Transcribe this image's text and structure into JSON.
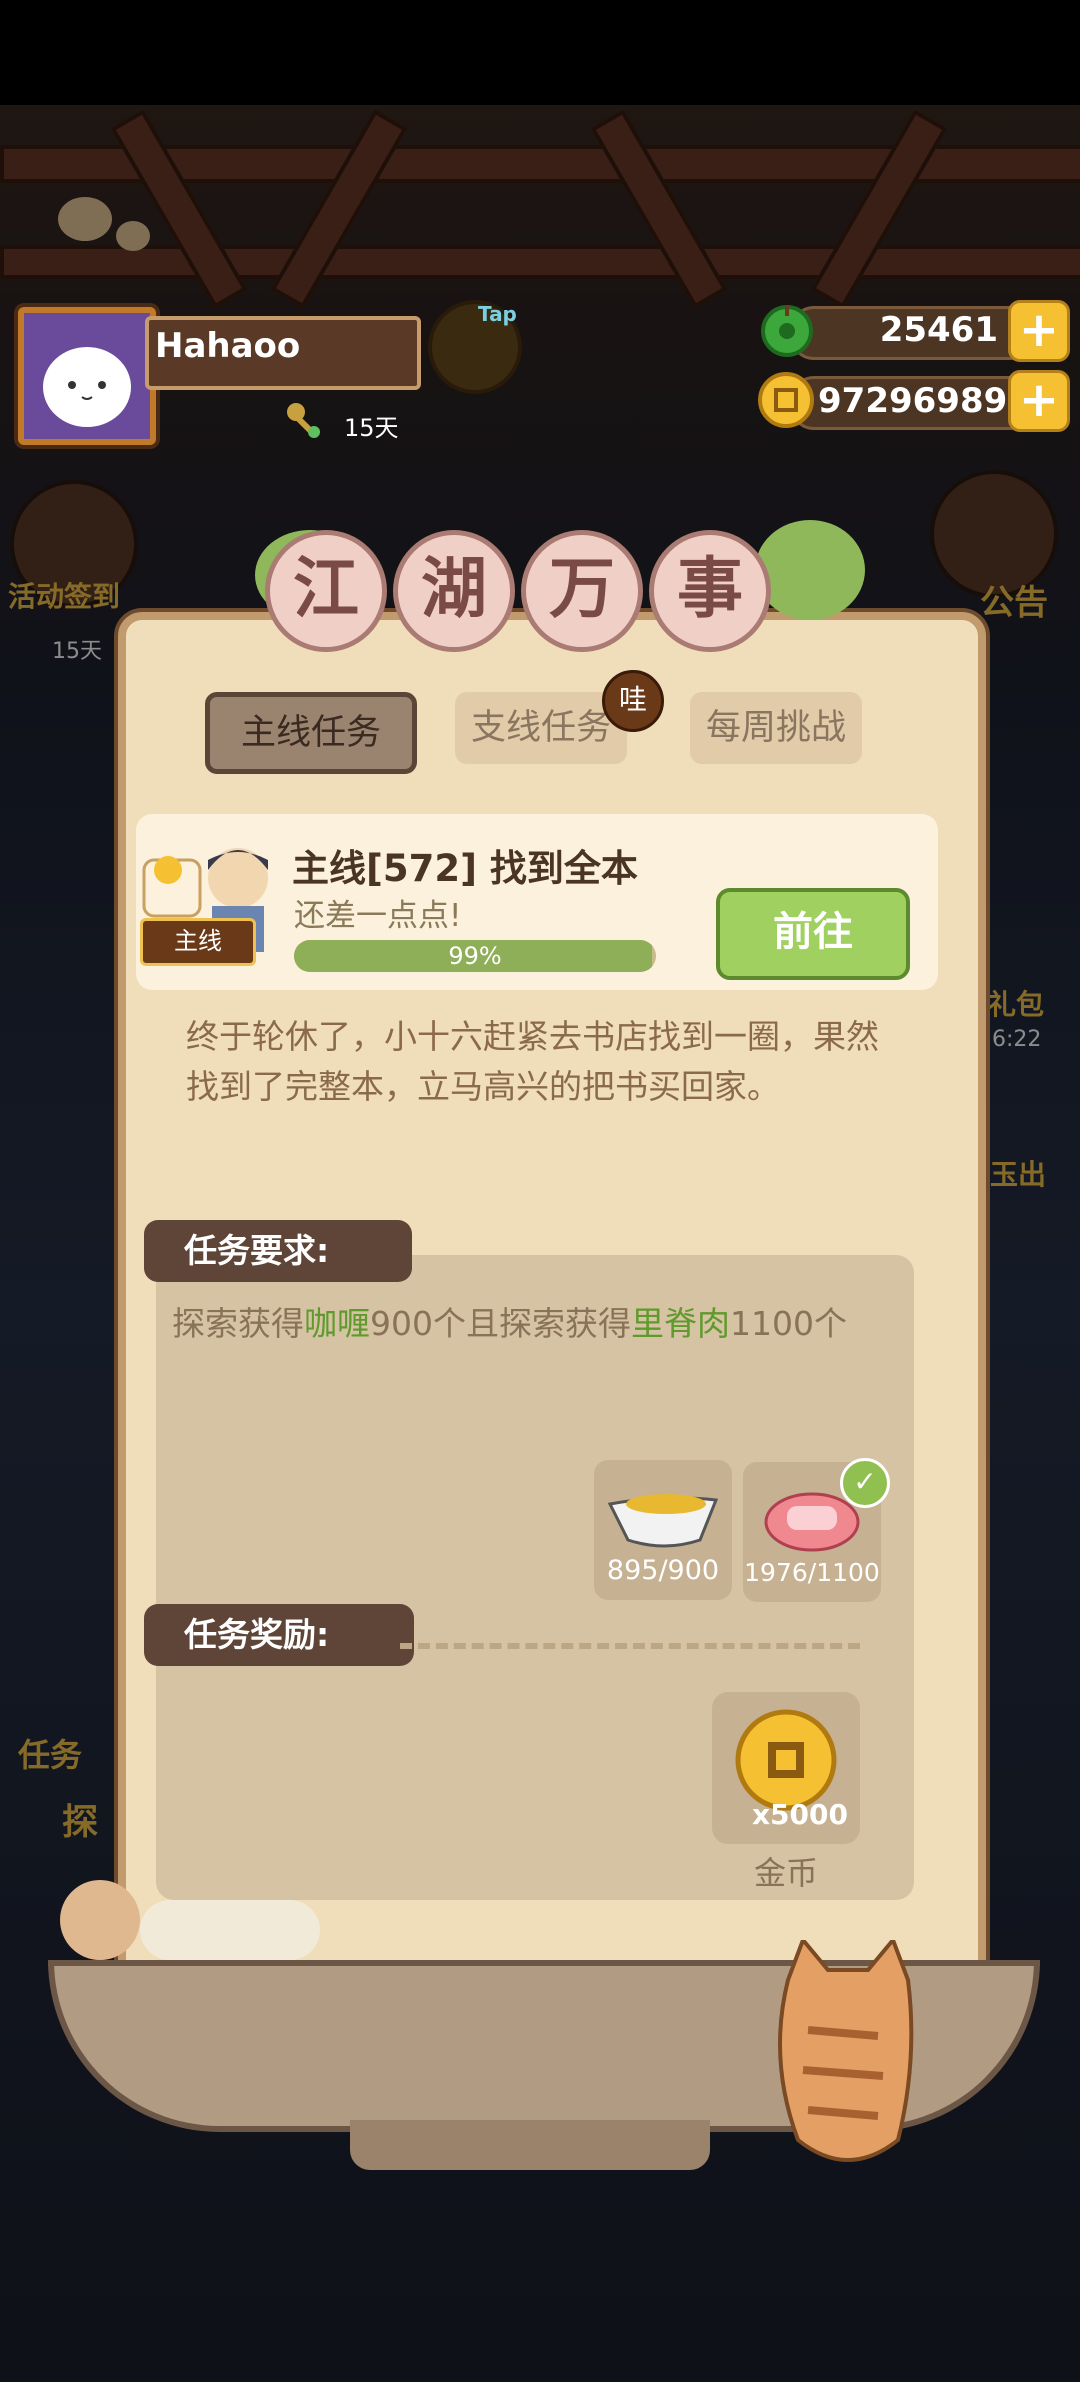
{
  "header": {
    "player_name": "Hahaoo",
    "days_label": "15天",
    "jade_count": "25461",
    "coin_count": "97296989",
    "tap_badge": "Tap"
  },
  "background": {
    "event_label": "活动签到",
    "event_days": "15天",
    "notice_label": "公告",
    "task_label": "任务",
    "explore_label": "探",
    "gift_label": "礼包",
    "timer": "6:22",
    "jade_label": "玉出"
  },
  "panel": {
    "title_chars": [
      "江",
      "湖",
      "万",
      "事"
    ],
    "tabs": {
      "main": "主线任务",
      "branch": "支线任务",
      "weekly": "每周挑战"
    },
    "branch_badge": "哇",
    "quest": {
      "tag": "主线",
      "title": "主线[572] 找到全本",
      "subtitle": "还差一点点!",
      "progress_text": "99%",
      "progress_value": 0.99,
      "go_button": "前往"
    },
    "description": "终于轮休了，小十六赶紧去书店找到一圈，果然找到了完整本，立马高兴的把书买回家。",
    "requirements": {
      "header": "任务要求:",
      "text_parts": [
        "探索获得",
        "咖喱",
        "900个且探索获得",
        "里脊肉",
        "1100个"
      ],
      "items": [
        {
          "icon": "curry-gravy-boat-icon",
          "count": "895/900",
          "complete": false
        },
        {
          "icon": "tenderloin-meat-icon",
          "count": "1976/1100",
          "complete": true
        }
      ]
    },
    "rewards": {
      "header": "任务奖励:",
      "items": [
        {
          "icon": "gold-coin-icon",
          "amount": "x5000",
          "label": "金币"
        }
      ]
    }
  },
  "colors": {
    "highlight_green": "#5f9a2c",
    "button_green": "#9fd060",
    "panel_bg": "#f0ddb9",
    "coin_gold": "#f5c032"
  }
}
